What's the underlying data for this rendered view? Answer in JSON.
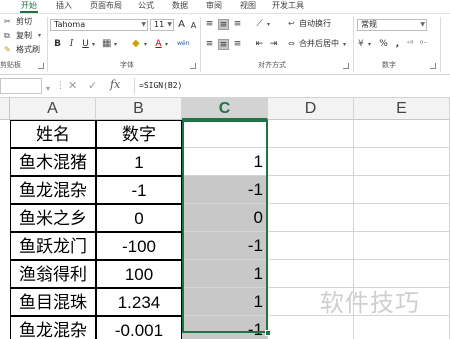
{
  "tabs": [
    {
      "label": "开始",
      "active": true
    },
    {
      "label": "插入"
    },
    {
      "label": "页面布局"
    },
    {
      "label": "公式"
    },
    {
      "label": "数据"
    },
    {
      "label": "审阅"
    },
    {
      "label": "视图"
    },
    {
      "label": "开发工具"
    }
  ],
  "ribbon": {
    "clipboard": {
      "cut": "剪切",
      "copy": "复制",
      "format_painter": "格式刷",
      "group_label": "剪贴板"
    },
    "font": {
      "name": "Tahoma",
      "size": "11",
      "grow": "A",
      "shrink": "A",
      "bold": "B",
      "italic": "I",
      "underline": "U",
      "font_color": "A",
      "phonetic": "wén",
      "group_label": "字体"
    },
    "alignment": {
      "wrap_text": "自动换行",
      "merge_center": "合并后居中",
      "group_label": "对齐方式"
    },
    "number": {
      "format": "常规",
      "percent": "%",
      "comma": ",",
      "group_label": "数字"
    }
  },
  "formula_bar": {
    "name_box": "",
    "formula": "=SIGN(B2)"
  },
  "columns": [
    "A",
    "B",
    "C",
    "D",
    "E"
  ],
  "headers": {
    "name": "姓名",
    "value": "数字",
    "result": ""
  },
  "rows": [
    {
      "name": "鱼木混猪",
      "value": "1",
      "result": "1"
    },
    {
      "name": "鱼龙混杂",
      "value": "-1",
      "result": "-1"
    },
    {
      "name": "鱼米之乡",
      "value": "0",
      "result": "0"
    },
    {
      "name": "鱼跃龙门",
      "value": "-100",
      "result": "-1"
    },
    {
      "name": "渔翁得利",
      "value": "100",
      "result": "1"
    },
    {
      "name": "鱼目混珠",
      "value": "1.234",
      "result": "1"
    },
    {
      "name": "鱼龙混杂",
      "value": "-0.001",
      "result": "-1"
    }
  ],
  "watermark": "软件技巧",
  "colors": {
    "accent": "#217346",
    "selection_fill": "#c8c8c8"
  }
}
